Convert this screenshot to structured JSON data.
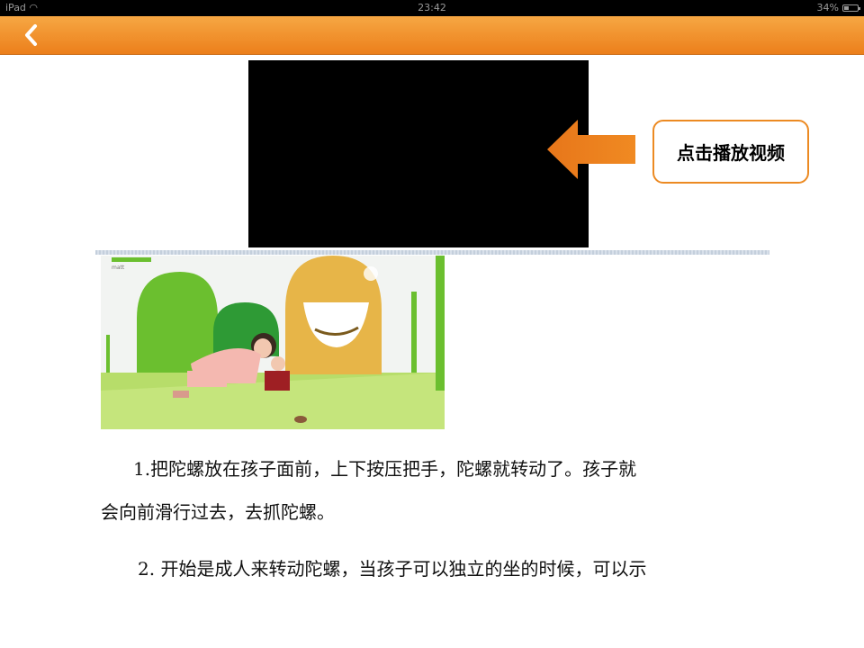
{
  "status_bar": {
    "device": "iPad",
    "time": "23:42",
    "battery_text": "34%",
    "battery_level": 0.34
  },
  "nav": {
    "back_icon": "chevron-left-icon",
    "color": "#ee8522"
  },
  "video": {
    "callout_text": "点击播放视频",
    "arrow_icon": "arrow-left-icon",
    "accent": "#ec7f1b"
  },
  "photo": {
    "brand_text": "matt"
  },
  "article": {
    "p1_line1": "1.把陀螺放在孩子面前，上下按压把手，陀螺就转动了。孩子就",
    "p1_line2": "会向前滑行过去，去抓陀螺。",
    "p2_line1": "2. 开始是成人来转动陀螺，当孩子可以独立的坐的时候，可以示"
  }
}
